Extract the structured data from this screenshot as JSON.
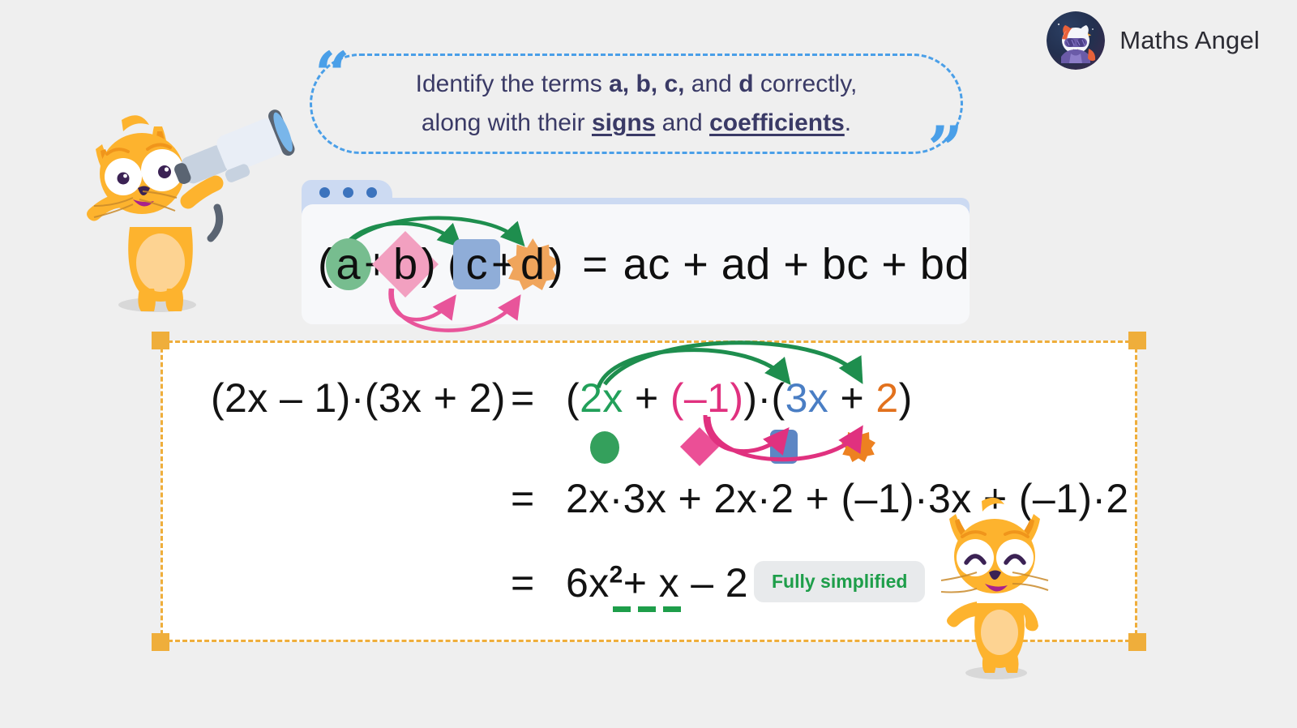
{
  "brand": {
    "name": "Maths Angel",
    "logo_icon": "astronaut-cat-logo",
    "colors": {
      "text": "#2b2b33"
    }
  },
  "quote": {
    "open_mark": "“",
    "close_mark": "”",
    "line1_pre": "Identify the terms ",
    "line1_bold": "a, b, c,",
    "line1_mid": " and ",
    "line1_bold2": "d",
    "line1_post": " correctly,",
    "line2_pre": "along with their ",
    "line2_u1": "signs",
    "line2_mid": " and ",
    "line2_u2": "coefficients",
    "line2_post": ".",
    "border_color": "#4a9fe8",
    "text_color": "#3a3a66"
  },
  "formula_card": {
    "dots_count": 3,
    "dot_color": "#3c73bd",
    "tokens": {
      "open1": "(",
      "a": "a",
      "plus1": "+",
      "b": "b",
      "close1": ")",
      "open2": "(",
      "c": "c",
      "plus2": "+",
      "d": "d",
      "close2": ")",
      "equals": "=",
      "expansion": "ac + ad + bc + bd"
    },
    "shapes": {
      "a": "ellipse-green",
      "b": "diamond-pink",
      "c": "rounded-square-blue",
      "d": "starburst-orange"
    },
    "arrows": {
      "green_label": "a-distributes",
      "pink_label": "b-distributes",
      "green_color": "#1e8e4e",
      "pink_color": "#e8549a"
    }
  },
  "worked_example": {
    "line1": {
      "left": "(2x – 1)·(3x + 2)",
      "equals": "=",
      "r_open": "(",
      "r_t1": "2x",
      "r_plus1": "+",
      "r_t2": "(–1)",
      "r_close1": ")",
      "r_dot": "·",
      "r_open2": "(",
      "r_t3": "3x",
      "r_plus2": "+",
      "r_t4": "2",
      "r_close2": ")"
    },
    "line2": {
      "equals": "=",
      "body": "2x·3x  +  2x·2  +  (–1)·3x  +  (–1)·2"
    },
    "line3": {
      "equals": "=",
      "coef": "6x",
      "exponent": "2",
      "rest": "+ x – 2"
    },
    "badge_label": "Fully simplified",
    "term_colors": {
      "t1": "#22a05a",
      "t2": "#e0317f",
      "t3": "#4a7ec4",
      "t4": "#e2711d"
    },
    "legend_shapes": [
      "circle-green",
      "diamond-pink",
      "rounded-square-blue",
      "starburst-orange"
    ],
    "underline_color": "#1e9e4a",
    "frame_color": "#efae3b"
  },
  "mascots": {
    "left": "cat-with-telescope",
    "right": "happy-cat-waving"
  }
}
